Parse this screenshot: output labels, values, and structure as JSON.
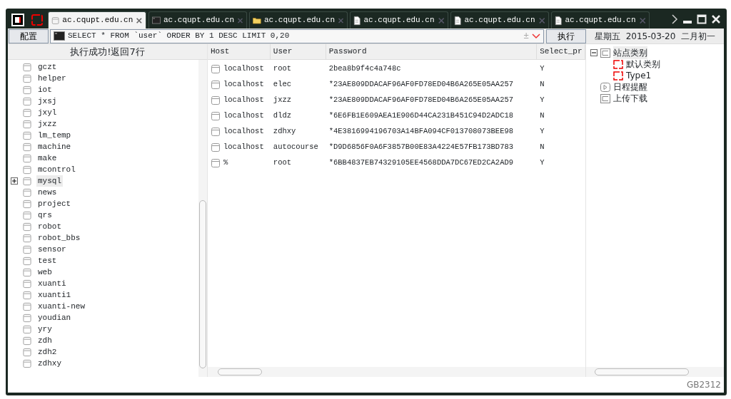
{
  "tabs": [
    {
      "label": "ac.cqupt.edu.cn",
      "kind": "database",
      "selected": true
    },
    {
      "label": "ac.cqupt.edu.cn",
      "kind": "console",
      "selected": false
    },
    {
      "label": "ac.cqupt.edu.cn",
      "kind": "folder",
      "selected": false
    },
    {
      "label": "ac.cqupt.edu.cn",
      "kind": "file",
      "selected": false
    },
    {
      "label": "ac.cqupt.edu.cn",
      "kind": "file",
      "selected": false
    },
    {
      "label": "ac.cqupt.edu.cn",
      "kind": "file",
      "selected": false
    }
  ],
  "toolbar": {
    "config_button": "配置",
    "query": "SELECT * FROM `user` ORDER BY 1 DESC LIMIT 0,20",
    "plus_minus": "±",
    "execute_button": "执行",
    "weekday": "星期五",
    "date": "2015-03-20",
    "lunar_date": "二月初一"
  },
  "databases": {
    "status": "执行成功!返回7行",
    "items": [
      {
        "name": "gczt",
        "expandable": false,
        "selected": false
      },
      {
        "name": "helper",
        "expandable": false,
        "selected": false
      },
      {
        "name": "iot",
        "expandable": false,
        "selected": false
      },
      {
        "name": "jxsj",
        "expandable": false,
        "selected": false
      },
      {
        "name": "jxyl",
        "expandable": false,
        "selected": false
      },
      {
        "name": "jxzz",
        "expandable": false,
        "selected": false
      },
      {
        "name": "lm_temp",
        "expandable": false,
        "selected": false
      },
      {
        "name": "machine",
        "expandable": false,
        "selected": false
      },
      {
        "name": "make",
        "expandable": false,
        "selected": false
      },
      {
        "name": "mcontrol",
        "expandable": false,
        "selected": false
      },
      {
        "name": "mysql",
        "expandable": true,
        "selected": true
      },
      {
        "name": "news",
        "expandable": false,
        "selected": false
      },
      {
        "name": "project",
        "expandable": false,
        "selected": false
      },
      {
        "name": "qrs",
        "expandable": false,
        "selected": false
      },
      {
        "name": "robot",
        "expandable": false,
        "selected": false
      },
      {
        "name": "robot_bbs",
        "expandable": false,
        "selected": false
      },
      {
        "name": "sensor",
        "expandable": false,
        "selected": false
      },
      {
        "name": "test",
        "expandable": false,
        "selected": false
      },
      {
        "name": "web",
        "expandable": false,
        "selected": false
      },
      {
        "name": "xuanti",
        "expandable": false,
        "selected": false
      },
      {
        "name": "xuanti1",
        "expandable": false,
        "selected": false
      },
      {
        "name": "xuanti-new",
        "expandable": false,
        "selected": false
      },
      {
        "name": "youdian",
        "expandable": false,
        "selected": false
      },
      {
        "name": "yry",
        "expandable": false,
        "selected": false
      },
      {
        "name": "zdh",
        "expandable": false,
        "selected": false
      },
      {
        "name": "zdh2",
        "expandable": false,
        "selected": false
      },
      {
        "name": "zdhxy",
        "expandable": false,
        "selected": false
      }
    ]
  },
  "table": {
    "columns": [
      "Host",
      "User",
      "Password",
      "Select_pr"
    ],
    "rows": [
      [
        "localhost",
        "root",
        "2bea8b9f4c4a748c",
        "Y"
      ],
      [
        "localhost",
        "elec",
        "*23AE809DDACAF96AF0FD78ED04B6A265E05AA257",
        "N"
      ],
      [
        "localhost",
        "jxzz",
        "*23AE809DDACAF96AF0FD78ED04B6A265E05AA257",
        "Y"
      ],
      [
        "localhost",
        "dldz",
        "*6E6FB1E609AEA1E906D44CA231B451C94D2ADC18",
        "N"
      ],
      [
        "localhost",
        "zdhxy",
        "*4E3816994196703A14BFA094CF013708073BEE98",
        "Y"
      ],
      [
        "localhost",
        "autocourse",
        "*D9D6856F0A6F3857B00E83A4224E57FB173BD783",
        "N"
      ],
      [
        "%",
        "root",
        "*6BB4837EB74329105EE4568DDA7DC67ED2CA2AD9",
        "Y"
      ]
    ]
  },
  "site_tree": [
    {
      "label": "站点类别",
      "kind": "group",
      "expanded": true,
      "selected": true,
      "children": [
        {
          "label": "默认类别",
          "kind": "category",
          "selected": false
        },
        {
          "label": "Type1",
          "kind": "category",
          "selected": false
        }
      ]
    },
    {
      "label": "日程提醒",
      "kind": "reminder",
      "selected": false
    },
    {
      "label": "上传下载",
      "kind": "group",
      "selected": false
    }
  ],
  "status_bar": {
    "encoding": "GB2312"
  }
}
